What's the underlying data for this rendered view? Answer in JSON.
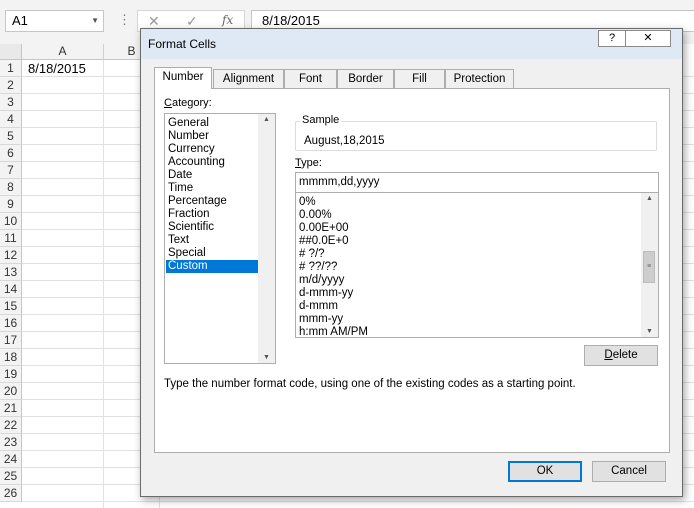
{
  "excel": {
    "name_box": "A1",
    "fx_icon": "fx",
    "formula_value": "8/18/2015",
    "columns": [
      "A",
      "B"
    ],
    "rows": [
      "1",
      "2",
      "3",
      "4",
      "5",
      "6",
      "7",
      "8",
      "9",
      "10",
      "11",
      "12",
      "13",
      "14",
      "15",
      "16",
      "17",
      "18",
      "19",
      "20",
      "21",
      "22",
      "23",
      "24",
      "25",
      "26"
    ],
    "cell_a1": "8/18/2015"
  },
  "dialog": {
    "title": "Format Cells",
    "help_label": "?",
    "close_label": "✕",
    "tabs": [
      "Number",
      "Alignment",
      "Font",
      "Border",
      "Fill",
      "Protection"
    ],
    "category_label": "Category:",
    "categories": [
      "General",
      "Number",
      "Currency",
      "Accounting",
      "Date",
      "Time",
      "Percentage",
      "Fraction",
      "Scientific",
      "Text",
      "Special",
      "Custom"
    ],
    "selected_category": "Custom",
    "sample_label": "Sample",
    "sample_value": "August,18,2015",
    "type_label": "Type:",
    "type_value": "mmmm,dd,yyyy",
    "type_list": [
      "0%",
      "0.00%",
      "0.00E+00",
      "##0.0E+0",
      "# ?/?",
      "# ??/??",
      "m/d/yyyy",
      "d-mmm-yy",
      "d-mmm",
      "mmm-yy",
      "h:mm AM/PM"
    ],
    "delete_label": "Delete",
    "help_text": "Type the number format code, using one of the existing codes as a starting point.",
    "ok_label": "OK",
    "cancel_label": "Cancel"
  }
}
